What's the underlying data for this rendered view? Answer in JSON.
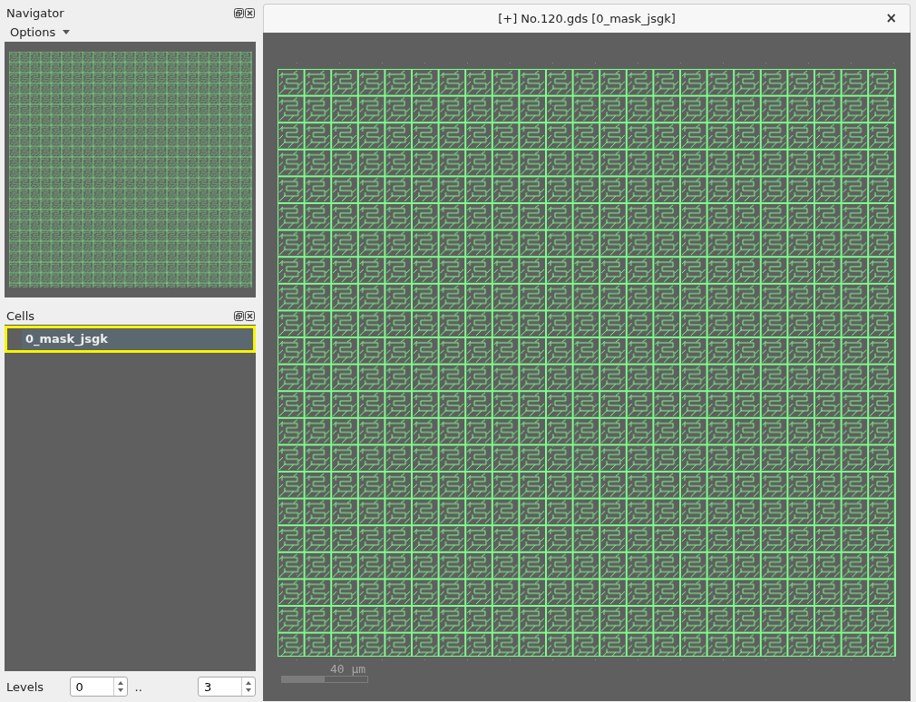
{
  "navigator": {
    "title": "Navigator",
    "options_menu": "Options"
  },
  "cells": {
    "title": "Cells",
    "items": [
      {
        "name": "0_mask_jsgk",
        "selected": true
      }
    ]
  },
  "levels": {
    "label": "Levels",
    "from": "0",
    "separator": "..",
    "to": "3"
  },
  "layout_tab": {
    "title": "[+] No.120.gds [0_mask_jsgk]",
    "close": "×",
    "scale_label": "40  µm"
  }
}
